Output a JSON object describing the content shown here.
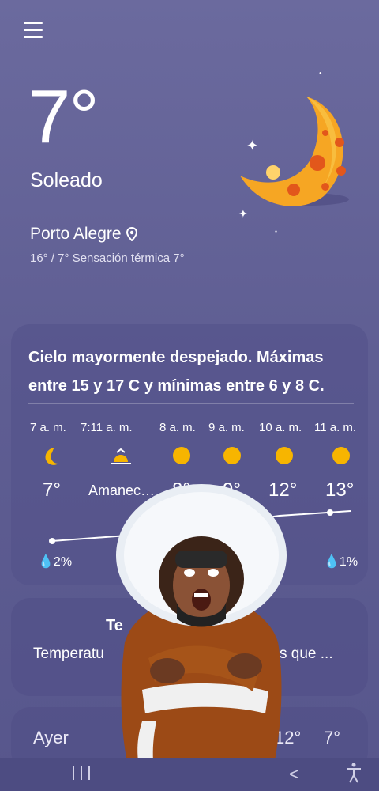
{
  "current": {
    "temperature": "7°",
    "condition": "Soleado",
    "city": "Porto Alegre",
    "range": "16° / 7° Sensación térmica 7°"
  },
  "forecast": {
    "summary": "Cielo mayormente despejado. Máximas entre 15 y 17 C y mínimas entre 6 y 8 C.",
    "hours": [
      {
        "time": "7 a. m.",
        "icon": "moon-icon",
        "temp": "7°",
        "precip": "2%"
      },
      {
        "time": "7:11 a. m.",
        "icon": "sunrise-icon",
        "temp": "Amanec…",
        "precip": ""
      },
      {
        "time": "8 a. m.",
        "icon": "sun-icon",
        "temp": "8°",
        "precip": ""
      },
      {
        "time": "9 a. m.",
        "icon": "sun-icon",
        "temp": "9°",
        "precip": ""
      },
      {
        "time": "10 a. m.",
        "icon": "sun-icon",
        "temp": "12°",
        "precip": ""
      },
      {
        "time": "11 a. m.",
        "icon": "sun-icon",
        "temp": "13°",
        "precip": "1%"
      }
    ]
  },
  "temperature_card": {
    "title": "Te",
    "description": "Temperatu",
    "description_tail": "s que ..."
  },
  "yesterday": {
    "label": "Ayer",
    "max": "12°",
    "min": "7°"
  },
  "colors": {
    "moon": "#f6a623",
    "sun": "#f7b500",
    "coat": "#9c4a16"
  },
  "navbar": {
    "back_label": "<"
  }
}
